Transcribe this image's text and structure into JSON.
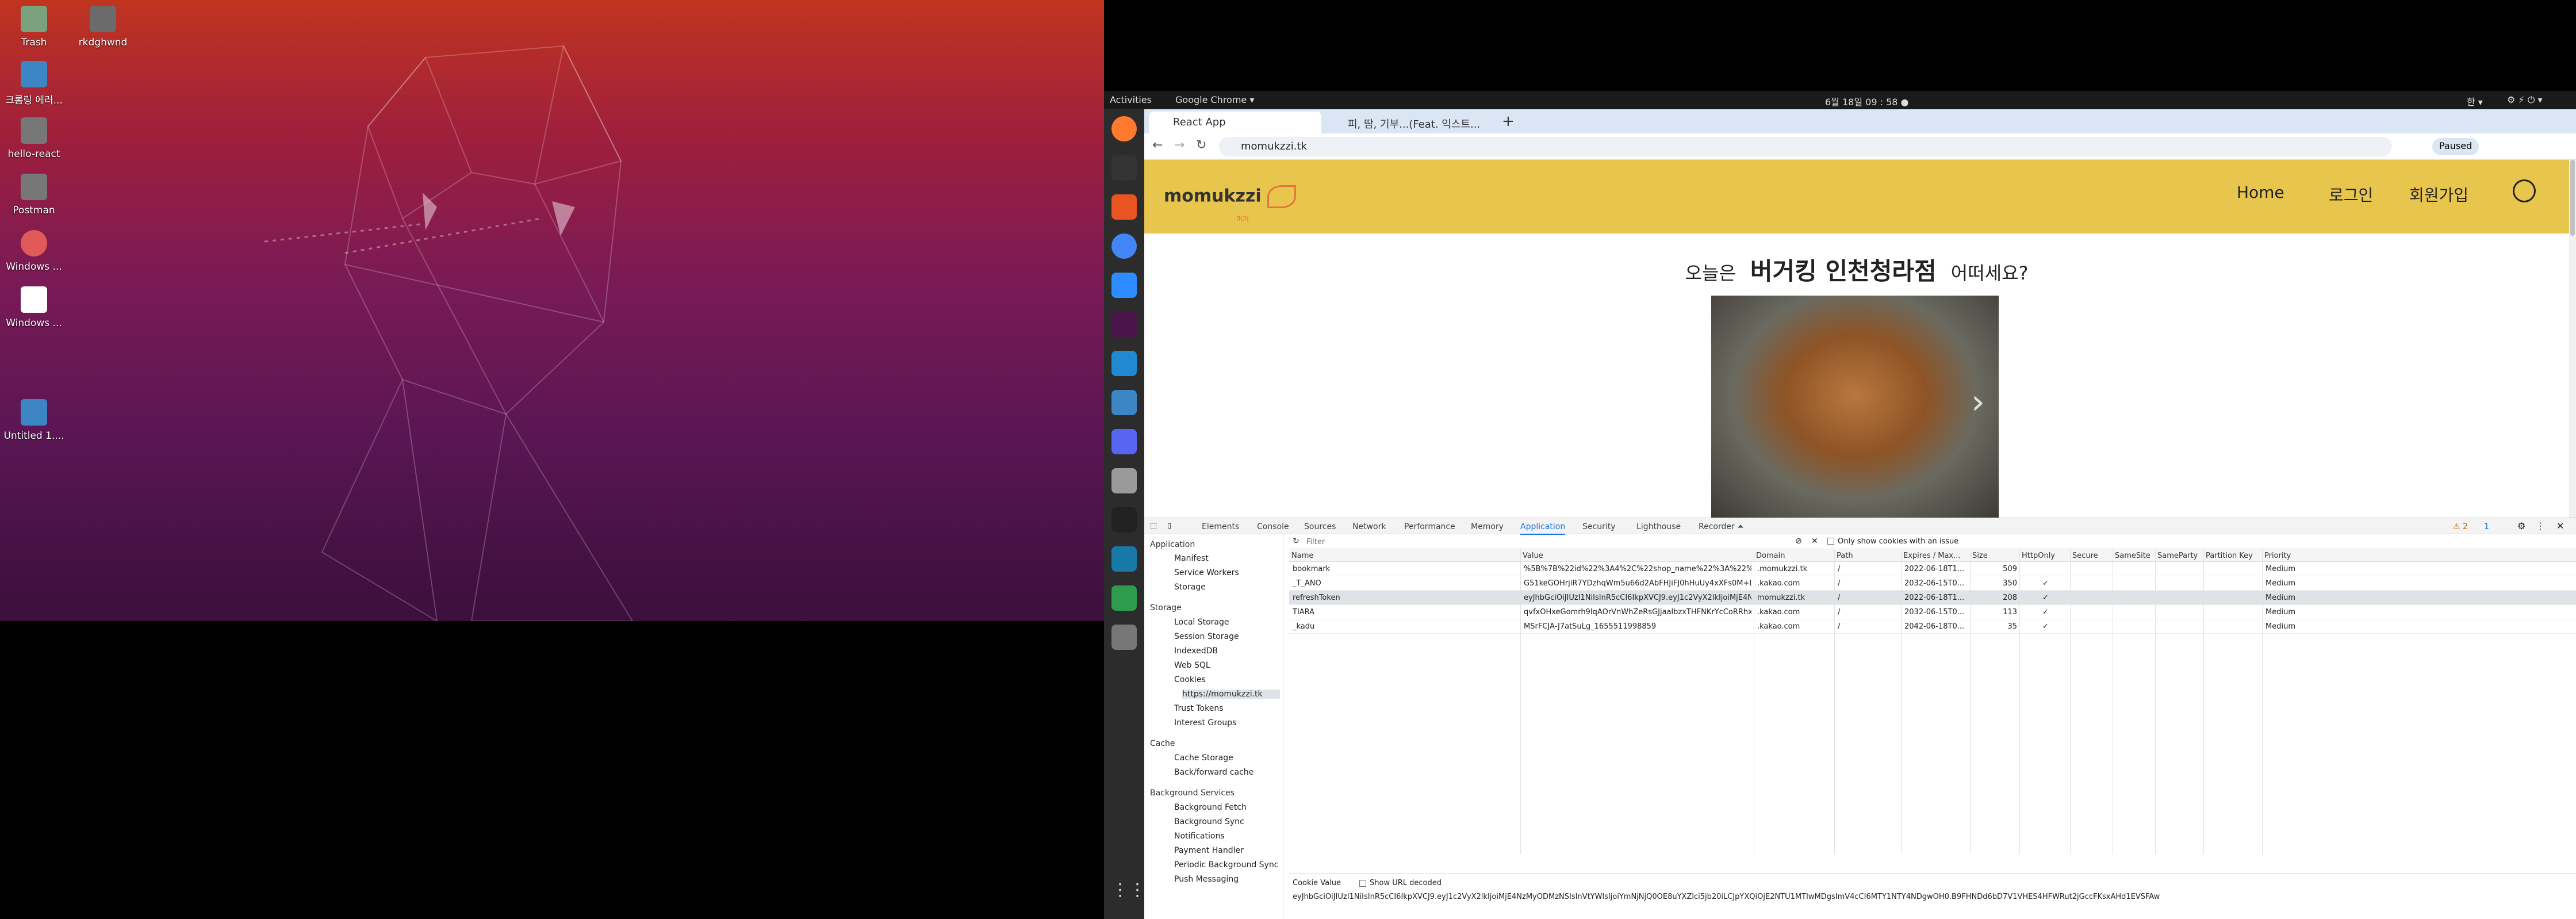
{
  "desktop": {
    "icons": [
      {
        "label": "Trash",
        "color": "#7aa27c"
      },
      {
        "label": "rkdghwnd",
        "color": "#6b6b6b"
      },
      {
        "label": "크롬링 에러...",
        "color": "#3d86c6"
      },
      {
        "label": "hello-react",
        "color": "#777"
      },
      {
        "label": "Postman",
        "color": "#777"
      },
      {
        "label": "Windows ...",
        "color": "#e05a5a"
      },
      {
        "label": "Windows ...",
        "color": "#ffffff"
      },
      {
        "label": "Untitled 1....",
        "color": "#3d86c6"
      }
    ]
  },
  "topbar": {
    "activities": "Activities",
    "app": "Google Chrome ▾",
    "clock": "6월 18일  09 : 58  ●",
    "input_method": "한 ▾"
  },
  "dock": {
    "items": [
      "firefox-icon",
      "terminal-icon",
      "software-icon",
      "chrome-icon",
      "zoom-icon",
      "slack-icon",
      "vscode-icon",
      "docs-icon",
      "discord-icon",
      "files-icon",
      "music-icon",
      "wireshark-icon",
      "todo-icon",
      "misc-icon"
    ]
  },
  "browser": {
    "tabs": [
      {
        "title": "React App"
      },
      {
        "title": "피, 땀, 기부...(Feat. 익스트..."
      }
    ],
    "new_tab": "+",
    "url": "momukzzi.tk",
    "profile_status": "Paused"
  },
  "site": {
    "logo": "momukzzi",
    "logo_sub": "머거",
    "nav": [
      "Home",
      "로그인",
      "회원가입"
    ],
    "greeting_prefix": "오늘은",
    "restaurant": "버거킹 인천청라점",
    "greeting_suffix": "어떠세요?",
    "carousel_next": "›"
  },
  "devtools": {
    "tabs": [
      "Elements",
      "Console",
      "Sources",
      "Network",
      "Performance",
      "Memory",
      "Application",
      "Security",
      "Lighthouse",
      "Recorder ⏶"
    ],
    "warnings": "⚠ 2",
    "issues": "1",
    "sidebar": {
      "application_header": "Application",
      "application_items": [
        "Manifest",
        "Service Workers",
        "Storage"
      ],
      "storage_header": "Storage",
      "storage_items": [
        "Local Storage",
        "Session Storage",
        "IndexedDB",
        "Web SQL",
        "Cookies",
        "https://momukzzi.tk",
        "Trust Tokens",
        "Interest Groups"
      ],
      "cache_header": "Cache",
      "cache_items": [
        "Cache Storage",
        "Back/forward cache"
      ],
      "bg_header": "Background Services",
      "bg_items": [
        "Background Fetch",
        "Background Sync",
        "Notifications",
        "Payment Handler",
        "Periodic Background Sync",
        "Push Messaging"
      ]
    },
    "filter_placeholder": "Filter",
    "only_issue_label": "Only show cookies with an issue",
    "columns": [
      "Name",
      "Value",
      "Domain",
      "Path",
      "Expires / Max...",
      "Size",
      "HttpOnly",
      "Secure",
      "SameSite",
      "SameParty",
      "Partition Key",
      "Priority"
    ],
    "rows": [
      {
        "name": "bookmark",
        "value": "%5B%7B%22id%22%3A4%2C%22shop_name%22%3A%22%EA%B2%8D%EB%8...",
        "domain": ".momukzzi.tk",
        "path": "/",
        "expires": "2022-06-18T1...",
        "size": "509",
        "httponly": "",
        "priority": "Medium"
      },
      {
        "name": "_T_ANO",
        "value": "G51keGOHrjiR7YDzhqWm5u66d2AbFHJiFJ0hHuUy4xXFs0M+Lb7nKx2PalmBIIBUN...",
        "domain": ".kakao.com",
        "path": "/",
        "expires": "2032-06-15T0...",
        "size": "350",
        "httponly": "✓",
        "priority": "Medium"
      },
      {
        "name": "refreshToken",
        "value": "eyJhbGciOiJIUzI1NiIsInR5cCI6IkpXVCJ9.eyJ1c2VyX2lkIjoiMjE4NzMyODMzNSIsIm...",
        "domain": "momukzzi.tk",
        "path": "/",
        "expires": "2022-06-18T1...",
        "size": "208",
        "httponly": "✓",
        "priority": "Medium"
      },
      {
        "name": "TIARA",
        "value": "qvfxOHxeGomrh9IqAOrVnWhZeRsGJjaalbzxTHFNKrYcCoRRhxSc_Pa97jrRBqlrGVv...",
        "domain": ".kakao.com",
        "path": "/",
        "expires": "2032-06-15T0...",
        "size": "113",
        "httponly": "✓",
        "priority": "Medium"
      },
      {
        "name": "_kadu",
        "value": "MSrFCJA-J7atSuLg_1655511998859",
        "domain": ".kakao.com",
        "path": "/",
        "expires": "2042-06-18T0...",
        "size": "35",
        "httponly": "✓",
        "priority": "Medium"
      }
    ],
    "cookie_value_label": "Cookie Value",
    "show_url_decoded": "Show URL decoded",
    "cookie_value": "eyJhbGciOiJIUzI1NiIsInR5cCI6IkpXVCJ9.eyJ1c2VyX2lkIjoiMjE4NzMyODMzNSIsInVtYWlsIjoiYmNjNjQ0OE8uYXZlci5jb20iLCJpYXQiOjE2NTU1MTIwMDgsImV4cCI6MTY1NTY4NDgwOH0.B9FHNDd6bD7V1VHES4HFWRut2jGccFKsxAHd1EVSFAw"
  }
}
